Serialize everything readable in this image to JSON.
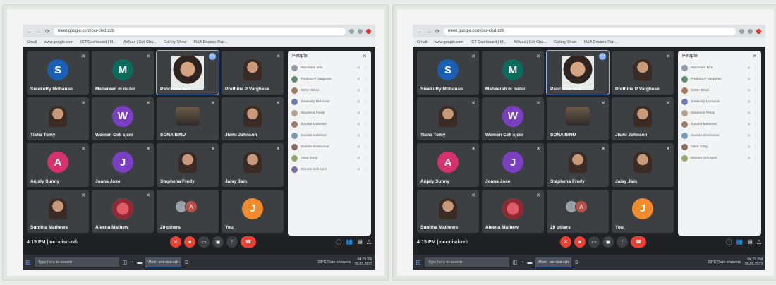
{
  "screens": [
    {
      "url": "meet.google.com/ocr-cisd-zzb",
      "bookmarks": [
        "Gmail",
        "www.google.com",
        "ICT Dashboard | M...",
        "ArtMax | Get Cha...",
        "Gallery Show",
        "M&A Dealers Rep..."
      ],
      "participants": [
        {
          "name": "Sreekutty Mohanan",
          "type": "letter",
          "letter": "S",
          "color": "#1a5fb4",
          "muted": true
        },
        {
          "name": "Mahereen m nazar",
          "type": "letter",
          "letter": "M",
          "color": "#0b6b5d",
          "muted": true
        },
        {
          "name": "Panchami M.S",
          "type": "self",
          "active": true
        },
        {
          "name": "Prethina P Varghese",
          "type": "photo",
          "muted": true
        },
        {
          "name": "Tisha Tomy",
          "type": "photo",
          "muted": true
        },
        {
          "name": "Women Cell sjcm",
          "type": "letter",
          "letter": "W",
          "color": "#7b3fc4",
          "muted": true
        },
        {
          "name": "SONA BINU",
          "type": "wide",
          "muted": true
        },
        {
          "name": "Jismi Johnson",
          "type": "photo",
          "muted": true
        },
        {
          "name": "Anjaly Sunny",
          "type": "letter",
          "letter": "A",
          "color": "#d6336c",
          "muted": true
        },
        {
          "name": "Joana Jose",
          "type": "letter",
          "letter": "J",
          "color": "#7b3fc4",
          "muted": true
        },
        {
          "name": "Stephena Fredy",
          "type": "photo",
          "muted": true
        },
        {
          "name": "Jaisy Jain",
          "type": "photo",
          "muted": true
        },
        {
          "name": "Sunitha Mathews",
          "type": "photo",
          "muted": true
        },
        {
          "name": "Aleena Mathew",
          "type": "flower",
          "muted": true
        },
        {
          "name": "20 others",
          "type": "others"
        },
        {
          "name": "You",
          "type": "letter",
          "letter": "J",
          "color": "#f28b2c",
          "muted": false
        }
      ],
      "people_title": "People",
      "people": [
        "Panchami M.S",
        "Prethina P Varghese",
        "SONA BINU",
        "Sreekutty Mohanan",
        "Stephena Fredy",
        "Sunitha Mathews",
        "Sunitha Mathews",
        "Swetha Sreekumar",
        "Tisha Tomy",
        "Women Cell sjcm"
      ],
      "meet_time": "4:15 PM  |  ocr-cisd-zzb",
      "taskbar_search": "Type here to search",
      "taskbar_app": "Meet - ocr-cisd-zzb",
      "weather": "29°C  Rain showers",
      "tray_time": "04:15 PM",
      "tray_date": "28-01-2022"
    },
    {
      "url": "meet.google.com/ocr-cisd-zzb",
      "bookmarks": [
        "Gmail",
        "www.google.com",
        "ICT Dashboard | M...",
        "ArtMax | Get Cha...",
        "Gallery Show",
        "M&A Dealers Rep..."
      ],
      "participants": [
        {
          "name": "Sreekutty Mohanan",
          "type": "letter",
          "letter": "S",
          "color": "#1a5fb4",
          "muted": true
        },
        {
          "name": "Maheerah m nazar",
          "type": "letter",
          "letter": "M",
          "color": "#0b6b5d",
          "muted": true
        },
        {
          "name": "Panchami M.S",
          "type": "self",
          "active": true
        },
        {
          "name": "Prethina P Varghese",
          "type": "photo",
          "muted": true
        },
        {
          "name": "Tisha Tomy",
          "type": "photo",
          "muted": true
        },
        {
          "name": "Women Cell sjcm",
          "type": "letter",
          "letter": "W",
          "color": "#7b3fc4",
          "muted": true
        },
        {
          "name": "SONA BINU",
          "type": "wide",
          "muted": true
        },
        {
          "name": "Jismi Johnson",
          "type": "photo",
          "muted": true
        },
        {
          "name": "Anjaly Sunny",
          "type": "letter",
          "letter": "A",
          "color": "#d6336c",
          "muted": true
        },
        {
          "name": "Joana Jose",
          "type": "letter",
          "letter": "J",
          "color": "#7b3fc4",
          "muted": true
        },
        {
          "name": "Stephena Fredy",
          "type": "photo",
          "muted": true
        },
        {
          "name": "Jaisy Jain",
          "type": "photo",
          "muted": true
        },
        {
          "name": "Sunitha Mathews",
          "type": "photo",
          "muted": true
        },
        {
          "name": "Aleena Mathew",
          "type": "flower",
          "muted": true
        },
        {
          "name": "20 others",
          "type": "others"
        },
        {
          "name": "You",
          "type": "letter",
          "letter": "J",
          "color": "#f28b2c",
          "muted": false
        }
      ],
      "people_title": "People",
      "people": [
        "Panchami M.S",
        "Prethina P Varghese",
        "SONA BINU",
        "Sreekutty Mohanan",
        "Stephena Fredy",
        "Sunitha Mathews",
        "Swetha Sreekumar",
        "Tisha Tomy",
        "Women Cell sjcm"
      ],
      "meet_time": "4:15 PM  |  ocr-cisd-zzb",
      "taskbar_search": "Type here to search",
      "taskbar_app": "Meet - ocr-cisd-zzb",
      "weather": "29°C  Rain showers",
      "tray_time": "04:15 PM",
      "tray_date": "28-01-2022"
    }
  ]
}
